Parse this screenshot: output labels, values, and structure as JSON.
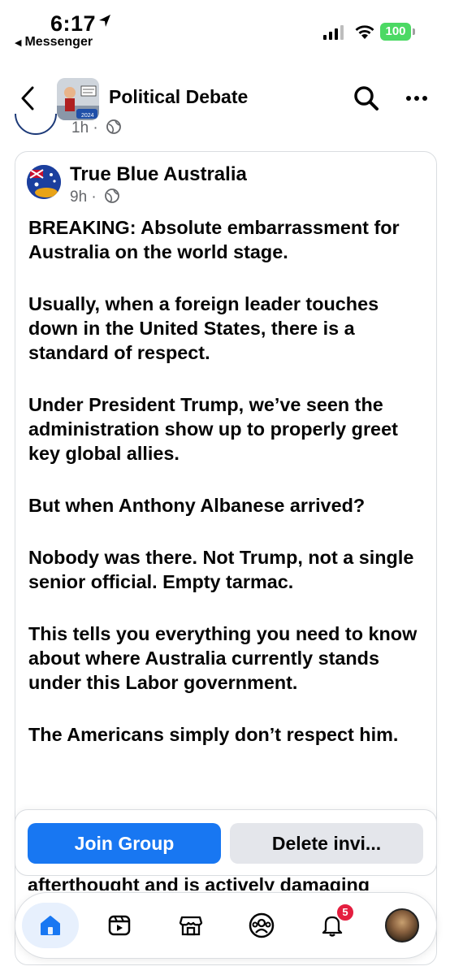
{
  "status_bar": {
    "time": "6:17",
    "back_app": "Messenger",
    "battery": "100"
  },
  "header": {
    "title": "Political Debate"
  },
  "prev_post": {
    "meta": "1h ·"
  },
  "post": {
    "author": "True Blue Australia",
    "time": "9h ·",
    "paragraphs": [
      "BREAKING: Absolute embarrassment for Australia on the world stage.",
      "Usually, when a foreign leader touches down in the United States, there is a standard of respect.",
      "Under President Trump, we’ve seen the administration show up to properly greet key global allies.",
      "But when Anthony Albanese arrived?",
      "Nobody was there. Not Trump, not a single senior official. Empty tarmac.",
      "This tells you everything you need to know about where Australia currently stands under this Labor government.",
      "The Americans simply don’t respect him."
    ],
    "trailing_text": "afterthought and is actively damaging"
  },
  "join_bar": {
    "join_label": "Join Group",
    "delete_label": "Delete invi..."
  },
  "bottom_nav": {
    "items": [
      {
        "icon": "home-icon"
      },
      {
        "icon": "video-icon"
      },
      {
        "icon": "marketplace-icon"
      },
      {
        "icon": "groups-icon"
      },
      {
        "icon": "notifications-icon"
      },
      {
        "icon": "profile-icon"
      }
    ],
    "notification_count": "5"
  },
  "colors": {
    "accent": "#1877f2",
    "badge": "#e41e3f",
    "battery": "#4cd964"
  }
}
